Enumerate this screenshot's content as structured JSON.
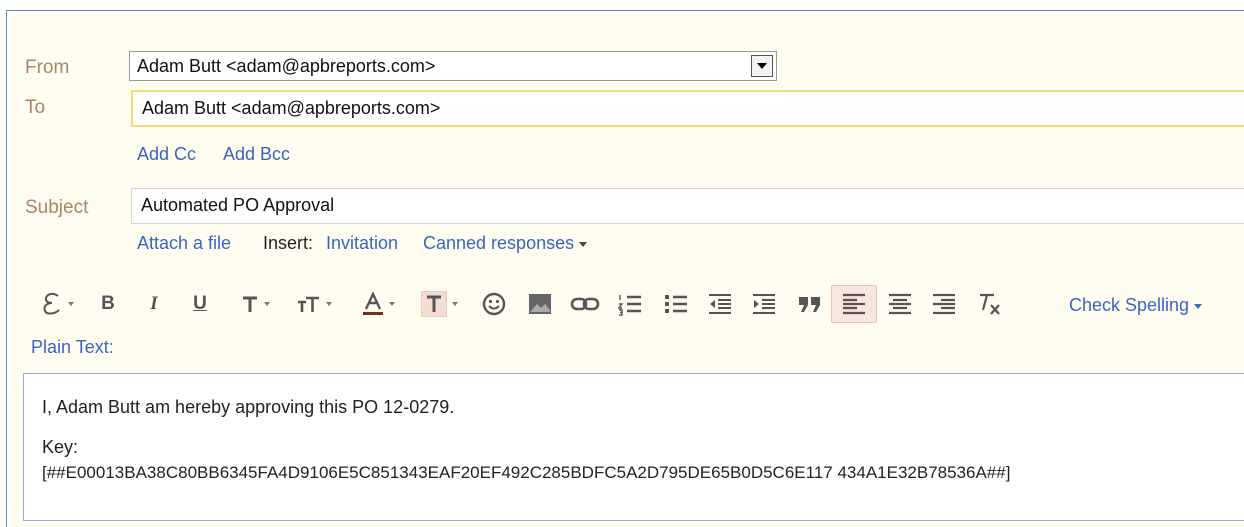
{
  "from": {
    "label": "From",
    "value": "Adam Butt <adam@apbreports.com>"
  },
  "to": {
    "label": "To",
    "value": "Adam Butt <adam@apbreports.com>"
  },
  "cc_links": {
    "add_cc": "Add Cc",
    "add_bcc": "Add Bcc"
  },
  "subject": {
    "label": "Subject",
    "value": "Automated PO Approval"
  },
  "attachments": {
    "attach_file": "Attach a file",
    "insert_label": "Insert:",
    "invitation": "Invitation",
    "canned_responses": "Canned responses"
  },
  "toolbar": {
    "bold": "B",
    "italic": "I",
    "underline": "U",
    "check_spelling": "Check Spelling",
    "plain_text": "Plain Text:"
  },
  "message": {
    "line1": "I,  Adam Butt  am hereby approving this PO 12-0279.",
    "key_label": "Key:",
    "key_value": "[##E00013BA38C80BB6345FA4D9106E5C851343EAF20EF492C285BDFC5A2D795DE65B0D5C6E117 434A1E32B78536A##]"
  },
  "colors": {
    "link": "#3a63c4",
    "label": "#a8856c",
    "background": "#fffdf0",
    "focus_border": "#f0e070"
  }
}
